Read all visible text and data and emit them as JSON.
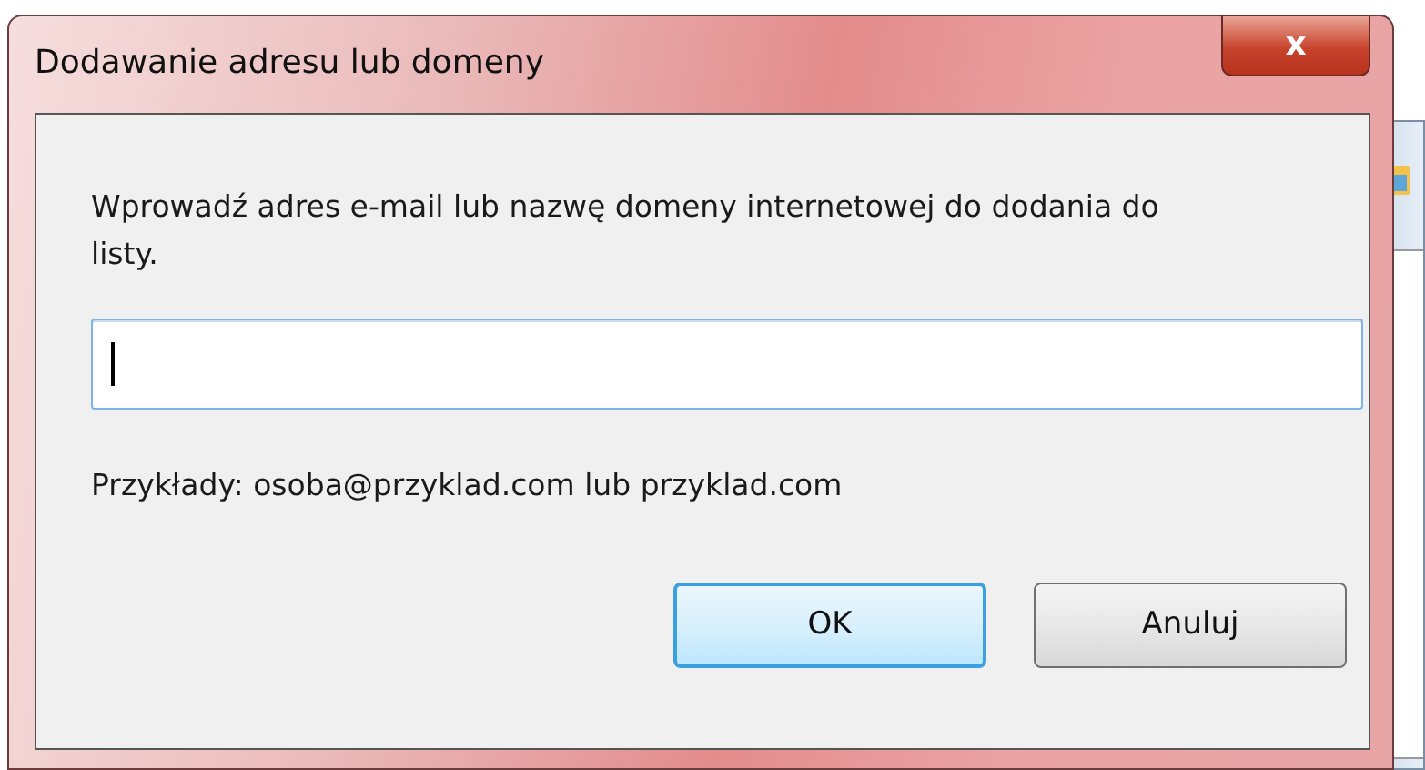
{
  "window": {
    "title": "Dodawanie adresu lub domeny",
    "close": "x"
  },
  "message": "Wprowadź adres e-mail lub nazwę domeny internetowej do dodania do listy.",
  "address_field": {
    "focused": true
  },
  "example": "Przykłady: osoba@przyklad.com lub przyklad.com",
  "buttons": [
    {
      "label": "OK",
      "default": true
    },
    {
      "label": "Anuluj",
      "default": false
    }
  ]
}
